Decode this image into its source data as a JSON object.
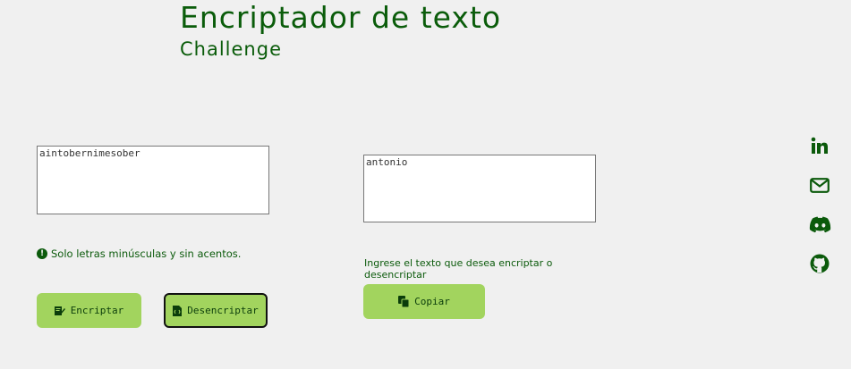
{
  "header": {
    "title": "Encriptador de texto",
    "subtitle": "Challenge"
  },
  "input": {
    "value": "aintobernimesober"
  },
  "output": {
    "value": "antonio"
  },
  "hint": {
    "icon": "exclamation-circle-icon",
    "text": "Solo letras minúsculas y sin acentos."
  },
  "info": {
    "text": "Ingrese el texto que desea encriptar o desencriptar"
  },
  "buttons": {
    "encrypt_label": "Encriptar",
    "decrypt_label": "Desencriptar",
    "copy_label": "Copiar"
  },
  "social": [
    {
      "icon": "linkedin-icon"
    },
    {
      "icon": "mail-icon"
    },
    {
      "icon": "discord-icon"
    },
    {
      "icon": "github-icon"
    }
  ],
  "colors": {
    "background": "#f0f0f0",
    "primary_text": "#0b5a0b",
    "button": "#a2d45e"
  }
}
